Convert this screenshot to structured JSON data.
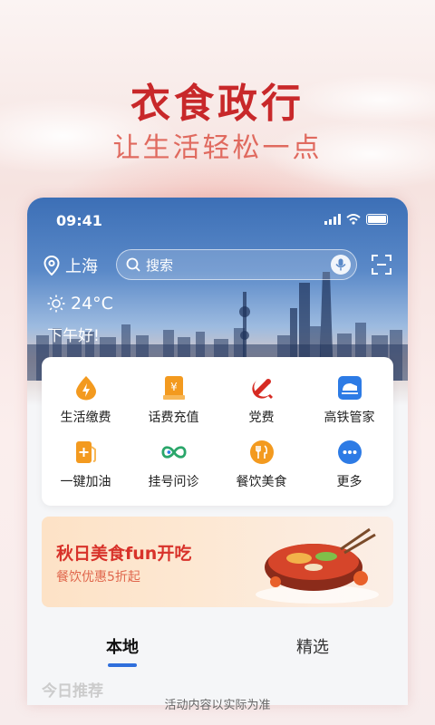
{
  "promo": {
    "title": "衣食政行",
    "subtitle": "让生活轻松一点"
  },
  "status_bar": {
    "time": "09:41"
  },
  "header": {
    "location": "上海",
    "search_placeholder": "搜索"
  },
  "weather": {
    "temperature": "24°C",
    "greeting": "下午好!"
  },
  "services": [
    {
      "label": "生活缴费",
      "icon": "lightning-drop-icon",
      "color": "#f39a1f"
    },
    {
      "label": "话费充值",
      "icon": "phone-bill-icon",
      "color": "#f39a1f"
    },
    {
      "label": "党费",
      "icon": "party-emblem-icon",
      "color": "#d62a22"
    },
    {
      "label": "高铁管家",
      "icon": "train-icon",
      "color": "#2d7be5"
    },
    {
      "label": "一键加油",
      "icon": "fuel-icon",
      "color": "#f39a1f"
    },
    {
      "label": "挂号问诊",
      "icon": "medical-icon",
      "color": "#2aa66a"
    },
    {
      "label": "餐饮美食",
      "icon": "dining-icon",
      "color": "#f39a1f"
    },
    {
      "label": "更多",
      "icon": "more-dots-icon",
      "color": "#2d7be5"
    }
  ],
  "banner": {
    "title": "秋日美食fun开吃",
    "subtitle": "餐饮优惠5折起"
  },
  "tabs": [
    {
      "label": "本地",
      "active": true
    },
    {
      "label": "精选",
      "active": false
    }
  ],
  "section_title": "今日推荐",
  "footer_note": "活动内容以实际为准",
  "colors": {
    "accent_red": "#c8282a",
    "accent_blue": "#2f6fdc"
  }
}
